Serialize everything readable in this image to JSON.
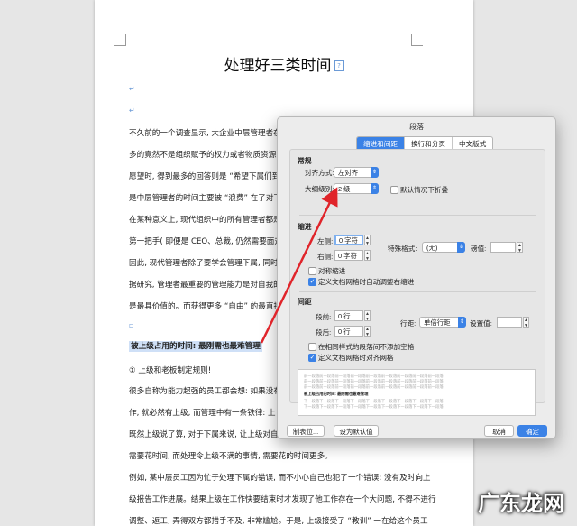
{
  "document": {
    "title": "处理好三类时间",
    "lines": [
      "不久前的一个调查显示, 大企业中层管理者在被",
      "多的竟然不是组织赋予的权力或者物质资源, 而",
      "愿望时, 得到最多的回答则是 “希望下属们到",
      "是中层管理者的时间主要被 “浪费” 在了对下属",
      "在某种意义上, 现代组织中的所有管理者都是 “",
      "第一把手( 即便是 CEO、总裁, 仍然需要面对董",
      "因此, 现代管理者除了要学会管理下属, 同时也",
      "据研究, 管理者最重要的管理能力是对自我的管",
      "是最具价值的。而获得更多 “自由” 的最直接且"
    ],
    "heading": "被上级占用的时间: 最刚需也最难管理",
    "sub_item": "① 上级和老板制定规则!",
    "lines2": [
      "很多自称为能力超强的员工都会想: 如果没有上",
      "作, 就必然有上级, 而管理中有一条铁律: 上",
      "既然上级说了算, 对于下属来说, 让上级对自己",
      "需要花时间, 而处理令上级不满的事情, 需要花的时间更多。",
      "例如, 某中层员工因为忙于处理下属的错误, 而不小心自己也犯了一个错误: 没有及时向上",
      "级报告工作进展。结果上级在工作快要结束时才发现了他工作存在一个大问题, 不得不进行",
      "调整、返工, 弄得双方都措手不及, 非常尴尬。于是, 上级接受了 “教训” 一在给这个员工"
    ]
  },
  "dialog": {
    "title": "段落",
    "tabs": [
      "缩进和间距",
      "换行和分页",
      "中文版式"
    ],
    "section_general": "常规",
    "align_label": "对齐方式:",
    "align_value": "左对齐",
    "outline_label": "大纲级别:",
    "outline_value": "2 级",
    "collapse_label": "默认情况下折叠",
    "section_indent": "缩进",
    "left_label": "左侧:",
    "left_value": "0 字符",
    "right_label": "右侧:",
    "right_value": "0 字符",
    "special_label": "特殊格式:",
    "special_value": "(无)",
    "measure_label": "磅值:",
    "mirror_label": "对称缩进",
    "grid_indent_label": "定义文档网格时自动调整右缩进",
    "section_spacing": "间距",
    "before_label": "段前:",
    "before_value": "0 行",
    "after_label": "段后:",
    "after_value": "0 行",
    "line_spacing_label": "行距:",
    "line_spacing_value": "单倍行距",
    "setting_label": "设置值:",
    "no_space_label": "在相同样式的段落间不添加空格",
    "snap_grid_label": "定义文档网格时对齐网格",
    "preview_prev": "前一段落前一段落前一段落前一段落前一段落前一段落前一段落前一段落前一段落",
    "preview_main": "被上级占用的时间: 最刚需也最难管理",
    "preview_next": "下一段落下一段落下一段落下一段落下一段落下一段落下一段落下一段落下一段落",
    "tabs_button": "制表位...",
    "default_button": "设为默认值",
    "cancel_button": "取消",
    "ok_button": "确定"
  },
  "watermark": "广东龙网",
  "colors": {
    "accent": "#3b82e6",
    "arrow": "#e0242a",
    "highlight": "#cfe0f7"
  }
}
